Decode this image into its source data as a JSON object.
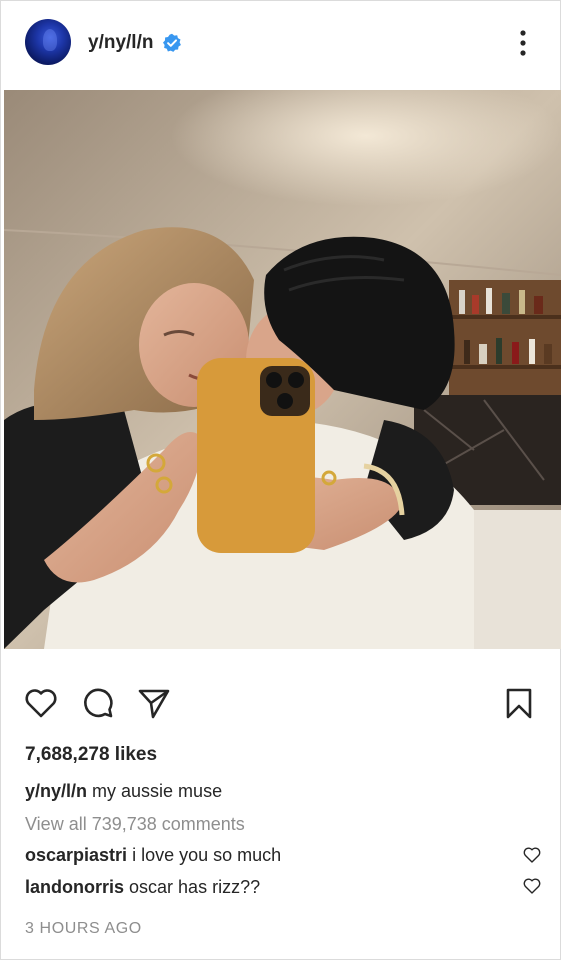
{
  "post": {
    "author": {
      "username": "y/ny/l/n",
      "verified": true,
      "avatar": "blue-abstract-avatar"
    },
    "image": {
      "description_icon": "couple-mirror-selfie-photo",
      "phone_case_color": "#d79a3a"
    },
    "actions": {
      "like_icon": "heart-icon",
      "comment_icon": "comment-icon",
      "share_icon": "paper-plane-icon",
      "save_icon": "bookmark-icon"
    },
    "likes": "7,688,278 likes",
    "caption": {
      "username": "y/ny/l/n",
      "text": "my aussie muse"
    },
    "view_all_comments": "View all 739,738 comments",
    "comments": [
      {
        "username": "oscarpiastri",
        "text": "i love you so much"
      },
      {
        "username": "landonorris",
        "text": "oscar has rizz??"
      }
    ],
    "timestamp": "3 HOURS AGO"
  },
  "colors": {
    "text": "#262626",
    "muted": "#8e8e8e",
    "verified_blue": "#3897f0",
    "border": "#dbdbdb"
  }
}
